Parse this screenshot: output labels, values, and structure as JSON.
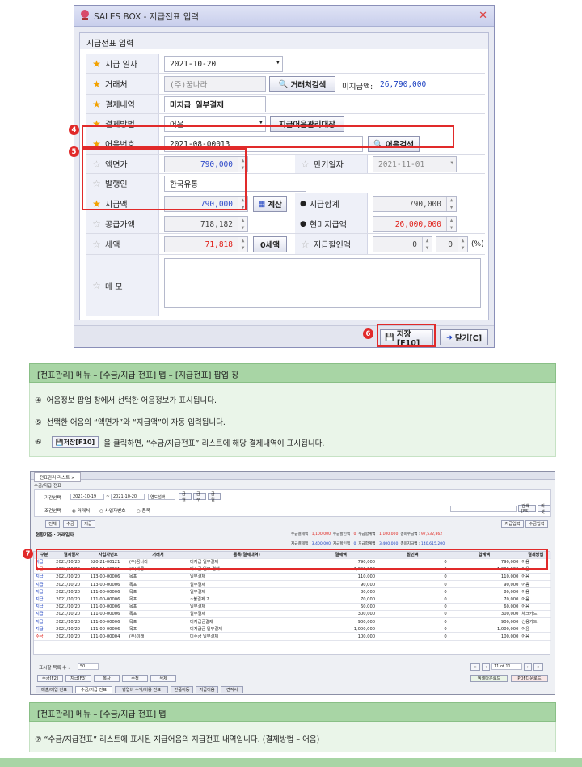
{
  "dialog": {
    "title": "SALES BOX - 지급전표 입력",
    "panel_title": "지급전표 입력",
    "fields": {
      "pay_date_label": "지급 일자",
      "pay_date": "2021-10-20",
      "vendor_label": "거래처",
      "vendor": "(주)꿈나라",
      "vendor_search_btn": "거래처검색",
      "unpaid_label": "미지급액:",
      "unpaid_value": "26,790,000",
      "desc_label": "결제내역",
      "desc_value": "미지급 일부결제",
      "method_label": "결제방법",
      "method_value": "어음",
      "ledger_btn": "지급어음관리대장",
      "note_no_label": "어음번호",
      "note_no_value": "2021-08-00013",
      "note_search_btn": "어음검색",
      "face_label": "액면가",
      "face_value": "790,000",
      "due_label": "만기일자",
      "due_value": "2021-11-01",
      "issuer_label": "발행인",
      "issuer_value": "한국유통",
      "pay_amt_label": "지급액",
      "pay_amt_value": "790,000",
      "calc_btn": "계산",
      "pay_total_label": "지급합계",
      "pay_total_value": "790,000",
      "supply_label": "공급가액",
      "supply_value": "718,182",
      "cash_label": "현미지급액",
      "cash_value": "26,000,000",
      "tax_label": "세액",
      "tax_value": "71,818",
      "tax_btn": "0세액",
      "discount_label": "지급할인액",
      "discount_value1": "0",
      "discount_value2": "0",
      "pct": "(%)",
      "memo_label": "메 모"
    },
    "save_btn": "저장[F10]",
    "close_btn": "닫기[C]",
    "badges": [
      "4",
      "5",
      "6"
    ]
  },
  "caption1": {
    "header": "[전표관리] 메뉴 – [수금/지급 전표] 탭 – [지급전표] 팝업 창",
    "line1_num": "④",
    "line1": "어음정보 팝업 창에서 선택한 어음정보가 표시됩니다.",
    "line2_num": "⑤",
    "line2": "선택한 어음의 “액면가”와  “지급액”이 자동 입력됩니다.",
    "line3_num": "⑥",
    "line3_btn": "저장[F10]",
    "line3": "을 클릭하면, “수금/지급전표” 리스트에 해당 결제내역이 표시됩니다."
  },
  "shot2": {
    "window_tab": "전표관리 리스트",
    "subtab": "수금/지급 전표",
    "period_label": "기간선택",
    "date_from": "2021-10-19",
    "date_to": "2021-10-20",
    "year_select": "연도선택",
    "btn_today": "금월",
    "btn_prev": "금주",
    "btn_day": "금일",
    "cond_label": "조건선택",
    "opt1": "거래처",
    "opt2": "사업자번호",
    "opt3": "품목",
    "search_btn": "검색[F5]",
    "reset_btn": "리셋",
    "filter_all": "전체",
    "filter_in": "수금",
    "filter_out": "지급",
    "reg_btn": "지급입력",
    "recv_btn": "수금입력",
    "summary_label": "현황기준 : 거래일자",
    "sum1_label": "수금결제액 :",
    "sum1": "1,100,000",
    "sum2_label": "수금할인액 :",
    "sum2": "0",
    "sum3_label": "수금합계액 :",
    "sum3": "1,100,000",
    "sum4_label": "총미수금액 :",
    "sum4": "97,532,862",
    "sum5_label": "지급결제액 :",
    "sum5": "3,400,000",
    "sum6_label": "지급할인액 :",
    "sum6": "0",
    "sum7_label": "지급합계액 :",
    "sum7": "3,400,000",
    "sum8_label": "총미지급액 :",
    "sum8": "140,615,200",
    "columns": [
      "구분",
      "결제일자",
      "사업자번호",
      "거래처",
      "품목(결제내역)",
      "결제액",
      "할인액",
      "합계액",
      "결제방법"
    ],
    "rows": [
      [
        "지급",
        "2021/10/20",
        "520-21-00121",
        "(주)꿈나라",
        "미지급 일부결제",
        "790,000",
        "0",
        "790,000",
        "어음"
      ],
      [
        "수금",
        "2021/10/20",
        "250-11-00001",
        "(주)세룡",
        "미수금 일부 결제",
        "1,000,000",
        "0",
        "1,000,000",
        "어음"
      ],
      [
        "지급",
        "2021/10/20",
        "113-00-00006",
        "목포",
        "일부결제",
        "110,000",
        "0",
        "110,000",
        "어음"
      ],
      [
        "지급",
        "2021/10/20",
        "113-00-00006",
        "목포",
        "일부결제",
        "90,000",
        "0",
        "90,000",
        "어음"
      ],
      [
        "지급",
        "2021/10/20",
        "111-00-00006",
        "목포",
        "일부결제",
        "80,000",
        "0",
        "80,000",
        "어음"
      ],
      [
        "지급",
        "2021/10/20",
        "111-00-00006",
        "목포",
        "~불결제 2",
        "70,000",
        "0",
        "70,000",
        "어음"
      ],
      [
        "지급",
        "2021/10/20",
        "111-00-00006",
        "목포",
        "일부결제",
        "60,000",
        "0",
        "60,000",
        "어음"
      ],
      [
        "지급",
        "2021/10/20",
        "111-00-00006",
        "목포",
        "일부결제",
        "300,000",
        "0",
        "300,000",
        "체크카드"
      ],
      [
        "지급",
        "2021/10/20",
        "111-00-00006",
        "목포",
        "미지급금결제",
        "900,000",
        "0",
        "900,000",
        "신용카드"
      ],
      [
        "지급",
        "2021/10/20",
        "111-00-00006",
        "목포",
        "미지급금 일부결제",
        "1,000,000",
        "0",
        "1,000,000",
        "어음"
      ],
      [
        "수금",
        "2021/10/20",
        "111-00-00004",
        "(주)미래",
        "미수금 일부결제",
        "100,000",
        "0",
        "100,000",
        "어음"
      ]
    ],
    "page_size_label": "표시할 목록 수 :",
    "page_size": "50",
    "page_info": "11 of 11",
    "bottom_btns": [
      "수금[F2]",
      "지급[F3]",
      "복사",
      "수정",
      "삭제"
    ],
    "excel_btn": "엑셀다운로드",
    "pdf_btn": "PDF다운로드",
    "bottom_tabs": [
      "매출/매입 전표",
      "수금/지급 전표",
      "영업비 수익/비용 전표",
      "반품이동",
      "지급어음",
      "견적서"
    ],
    "badge": "7"
  },
  "caption2": {
    "header": "[전표관리] 메뉴 – [수금/지급 전표] 탭",
    "line1": "⑦ “수금/지급전표” 리스트에 표시된 지급어음의 지급전표 내역입니다. (결제방법 – 어음)"
  },
  "colors": {
    "accent_red": "#e12a2a",
    "caption_green": "#a8d5a5",
    "star": "#f2a100"
  }
}
